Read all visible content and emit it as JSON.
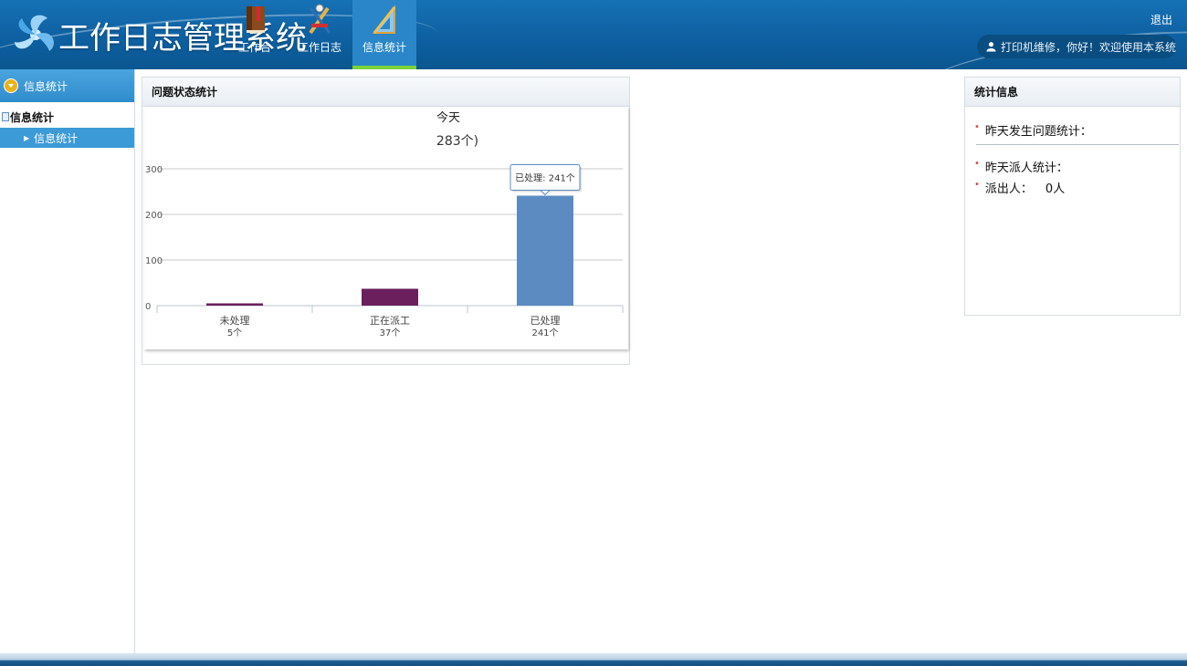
{
  "app": {
    "title": "工作日志管理系统",
    "logout_label": "退出",
    "user_greeting": "打印机维修，你好！欢迎使用本系统"
  },
  "nav": {
    "items": [
      {
        "label": "工作台",
        "icon": "book-icon"
      },
      {
        "label": "工作日志",
        "icon": "tools-icon"
      },
      {
        "label": "信息统计",
        "icon": "ruler-icon",
        "active": true
      }
    ]
  },
  "sidebar": {
    "header": "信息统计",
    "group": "信息统计",
    "items": [
      {
        "label": "信息统计",
        "selected": true
      }
    ]
  },
  "chart_panel": {
    "title": "问题状态统计"
  },
  "chart_data": {
    "type": "bar",
    "title": "今天",
    "subtitle": "283个)",
    "categories": [
      "未处理",
      "正在派工",
      "已处理"
    ],
    "category_sublabels": [
      "5个",
      "37个",
      "241个"
    ],
    "values": [
      5,
      37,
      241
    ],
    "colors": [
      "#6b1f5c",
      "#6b1f5c",
      "#5b8bc1"
    ],
    "ylim": [
      0,
      300
    ],
    "yticks": [
      0,
      100,
      200,
      300
    ],
    "grid": true,
    "tooltip": "已处理: 241个"
  },
  "stats_panel": {
    "title": "统计信息",
    "yesterday_issues_label": "昨天发生问题统计：",
    "yesterday_dispatch_label": "昨天派人统计：",
    "dispatched_label": "派出人：",
    "dispatched_value": "0人"
  }
}
